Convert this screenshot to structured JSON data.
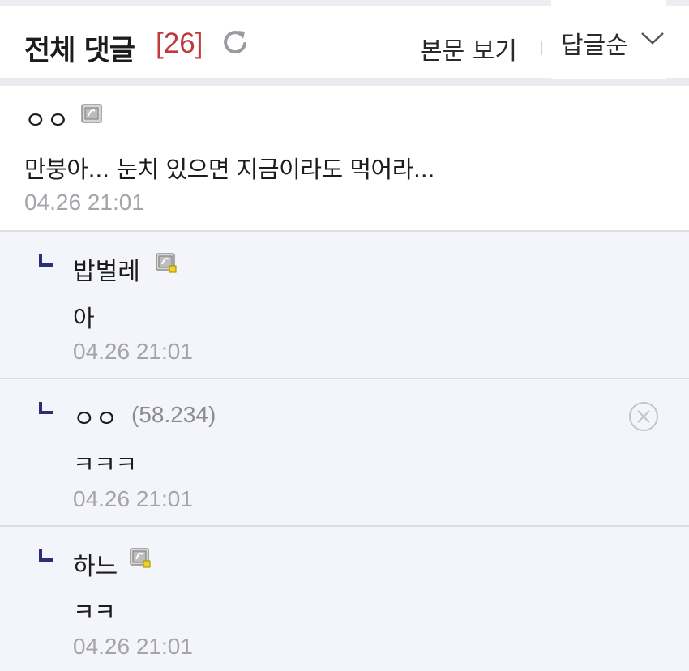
{
  "header": {
    "title": "전체 댓글",
    "count": "[26]",
    "view_post": "본문 보기",
    "sort_label": "답글순"
  },
  "comments": [
    {
      "author": "ㅇㅇ",
      "text": "만붕아... 눈치 있으면 지금이라도 먹어라...",
      "date": "04.26 21:01"
    }
  ],
  "replies": [
    {
      "author": "밥벌레",
      "text": "아",
      "date": "04.26 21:01"
    },
    {
      "author": "ㅇㅇ",
      "ip": "(58.234)",
      "text": "ㅋㅋㅋ",
      "date": "04.26 21:01"
    },
    {
      "author": "하느",
      "text": "ㅋㅋ",
      "date": "04.26 21:01"
    }
  ],
  "colors": {
    "count": "#c0393b",
    "reply_bg": "#f4f5fb",
    "reply_arrow": "#2b2f7a",
    "date": "#a4a4aa"
  }
}
